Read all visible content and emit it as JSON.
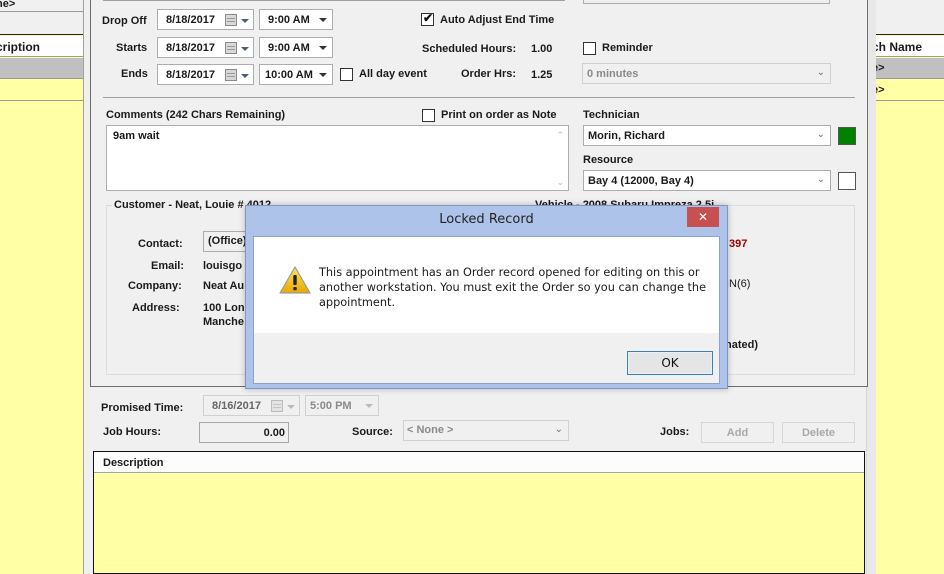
{
  "background_grid": {
    "left": {
      "top_row_text": "ne>",
      "header": "cription"
    },
    "right": {
      "header": "ch Name",
      "rows": [
        "e>",
        "e>"
      ]
    }
  },
  "schedule": {
    "drop_off": {
      "label": "Drop Off",
      "date": "8/18/2017",
      "time": "9:00 AM"
    },
    "starts": {
      "label": "Starts",
      "date": "8/18/2017",
      "time": "9:00 AM"
    },
    "ends": {
      "label": "Ends",
      "date": "8/18/2017",
      "time": "10:00 AM"
    },
    "all_day_event": {
      "label": "All day event",
      "checked": false
    },
    "auto_adjust": {
      "label": "Auto Adjust End Time",
      "checked": true
    },
    "scheduled_hours": {
      "label": "Scheduled Hours:",
      "value": "1.00"
    },
    "order_hrs": {
      "label": "Order Hrs:",
      "value": "1.25"
    },
    "reminder": {
      "label": "Reminder",
      "checked": false,
      "value": "0 minutes"
    }
  },
  "comments": {
    "label": "Comments (242 Chars Remaining)",
    "value": "9am wait",
    "print_on_order": {
      "label": "Print on order as Note",
      "checked": false
    }
  },
  "technician": {
    "label": "Technician",
    "value": "Morin, Richard",
    "color": "#008000"
  },
  "resource": {
    "label": "Resource",
    "value": "Bay 4 (12000, Bay 4)",
    "color": "#ffffff"
  },
  "customer": {
    "title": "Customer - Neat, Louie # 4012",
    "contact": {
      "label": "Contact:",
      "value": "(Office)"
    },
    "email": {
      "label": "Email:",
      "value": "louisgo"
    },
    "company": {
      "label": "Company:",
      "value": "Neat Au"
    },
    "address": {
      "label": "Address:",
      "line1": "100 Lon",
      "line2": "Manche"
    }
  },
  "vehicle": {
    "title": "Vehicle - 2008 Subaru Impreza 2.5i",
    "partial_1": "397",
    "partial_2": "IN(6)",
    "partial_3": "nated)"
  },
  "promised": {
    "label": "Promised Time:",
    "date": "8/16/2017",
    "time": "5:00 PM"
  },
  "job_hours": {
    "label": "Job Hours:",
    "value": "0.00"
  },
  "source": {
    "label": "Source:",
    "value": "< None >"
  },
  "jobs": {
    "label": "Jobs:",
    "add": "Add",
    "delete": "Delete"
  },
  "description_grid": {
    "header": "Description"
  },
  "dialog": {
    "title": "Locked Record",
    "close": "✕",
    "message": "This appointment has an Order record opened for editing on this or another workstation.  You must exit the Order so you can change the appointment.",
    "ok": "OK",
    "icon": "warning-icon"
  }
}
